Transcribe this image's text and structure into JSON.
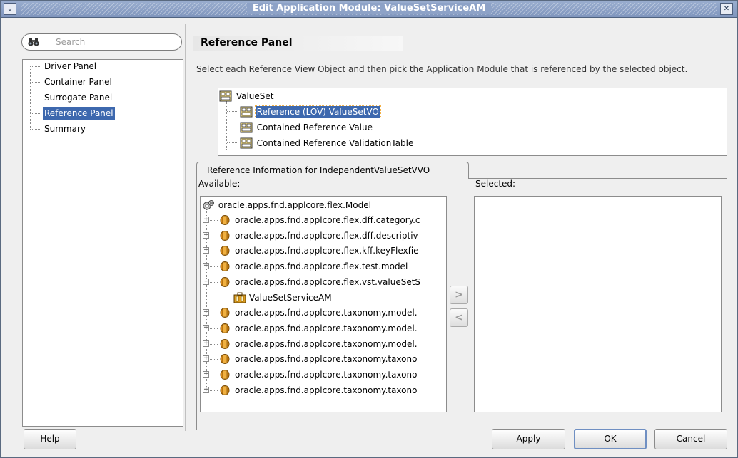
{
  "window": {
    "title": "Edit Application Module: ValueSetServiceAM",
    "menu_glyph": "⌄",
    "close_glyph": "✕"
  },
  "sidebar": {
    "search_placeholder": "Search",
    "items": [
      {
        "label": "Driver Panel"
      },
      {
        "label": "Container Panel"
      },
      {
        "label": "Surrogate Panel"
      },
      {
        "label": "Reference Panel",
        "selected": true
      },
      {
        "label": "Summary"
      }
    ]
  },
  "main": {
    "header": "Reference Panel",
    "description": "Select each Reference View Object and then pick the Application Module that is referenced by the selected object.",
    "tree": {
      "root": "ValueSet",
      "children": [
        {
          "label": "Reference (LOV) ValueSetVO",
          "selected": true
        },
        {
          "label": "Contained Reference Value"
        },
        {
          "label": "Contained Reference ValidationTable"
        }
      ]
    },
    "tab": {
      "label": "Reference Information for IndependentValueSetVVO"
    },
    "available_label": "Available:",
    "selected_label": "Selected:",
    "available": {
      "root": "oracle.apps.fnd.applcore.flex.Model",
      "packages": [
        {
          "label": "oracle.apps.fnd.applcore.flex.dff.category.c"
        },
        {
          "label": "oracle.apps.fnd.applcore.flex.dff.descriptiv"
        },
        {
          "label": "oracle.apps.fnd.applcore.flex.kff.keyFlexfie"
        },
        {
          "label": "oracle.apps.fnd.applcore.flex.test.model"
        },
        {
          "label": "oracle.apps.fnd.applcore.flex.vst.valueSetS",
          "expanded": true
        },
        {
          "label": "ValueSetServiceAM",
          "child": true
        },
        {
          "label": "oracle.apps.fnd.applcore.taxonomy.model."
        },
        {
          "label": "oracle.apps.fnd.applcore.taxonomy.model."
        },
        {
          "label": "oracle.apps.fnd.applcore.taxonomy.model."
        },
        {
          "label": "oracle.apps.fnd.applcore.taxonomy.taxono"
        },
        {
          "label": "oracle.apps.fnd.applcore.taxonomy.taxono"
        },
        {
          "label": "oracle.apps.fnd.applcore.taxonomy.taxono"
        }
      ]
    },
    "move_right_glyph": ">",
    "move_left_glyph": "<"
  },
  "footer": {
    "help": "Help",
    "apply": "Apply",
    "ok": "OK",
    "cancel": "Cancel"
  },
  "colors": {
    "selection": "#3d68ae",
    "titlebar": "#8da2c7"
  }
}
